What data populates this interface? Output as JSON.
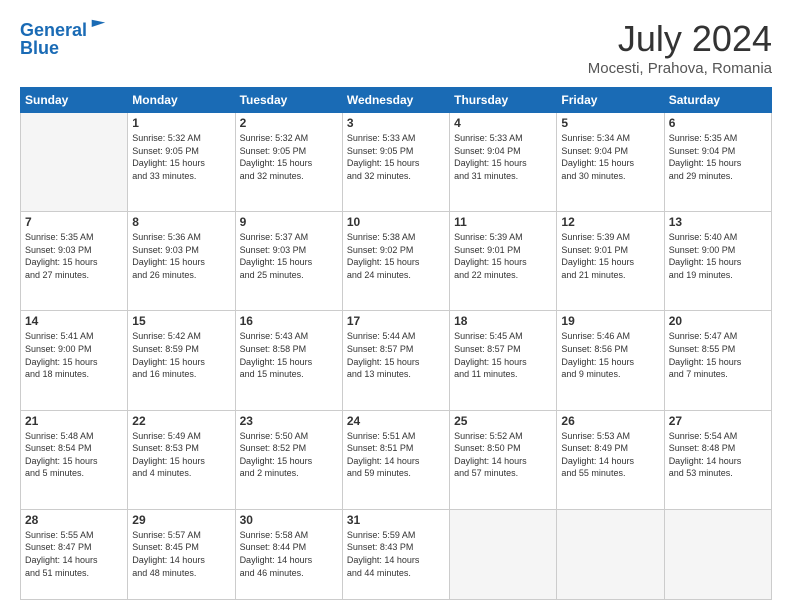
{
  "header": {
    "logo_line1": "General",
    "logo_line2": "Blue",
    "month": "July 2024",
    "location": "Mocesti, Prahova, Romania"
  },
  "weekdays": [
    "Sunday",
    "Monday",
    "Tuesday",
    "Wednesday",
    "Thursday",
    "Friday",
    "Saturday"
  ],
  "weeks": [
    [
      {
        "day": "",
        "info": ""
      },
      {
        "day": "1",
        "info": "Sunrise: 5:32 AM\nSunset: 9:05 PM\nDaylight: 15 hours\nand 33 minutes."
      },
      {
        "day": "2",
        "info": "Sunrise: 5:32 AM\nSunset: 9:05 PM\nDaylight: 15 hours\nand 32 minutes."
      },
      {
        "day": "3",
        "info": "Sunrise: 5:33 AM\nSunset: 9:05 PM\nDaylight: 15 hours\nand 32 minutes."
      },
      {
        "day": "4",
        "info": "Sunrise: 5:33 AM\nSunset: 9:04 PM\nDaylight: 15 hours\nand 31 minutes."
      },
      {
        "day": "5",
        "info": "Sunrise: 5:34 AM\nSunset: 9:04 PM\nDaylight: 15 hours\nand 30 minutes."
      },
      {
        "day": "6",
        "info": "Sunrise: 5:35 AM\nSunset: 9:04 PM\nDaylight: 15 hours\nand 29 minutes."
      }
    ],
    [
      {
        "day": "7",
        "info": "Sunrise: 5:35 AM\nSunset: 9:03 PM\nDaylight: 15 hours\nand 27 minutes."
      },
      {
        "day": "8",
        "info": "Sunrise: 5:36 AM\nSunset: 9:03 PM\nDaylight: 15 hours\nand 26 minutes."
      },
      {
        "day": "9",
        "info": "Sunrise: 5:37 AM\nSunset: 9:03 PM\nDaylight: 15 hours\nand 25 minutes."
      },
      {
        "day": "10",
        "info": "Sunrise: 5:38 AM\nSunset: 9:02 PM\nDaylight: 15 hours\nand 24 minutes."
      },
      {
        "day": "11",
        "info": "Sunrise: 5:39 AM\nSunset: 9:01 PM\nDaylight: 15 hours\nand 22 minutes."
      },
      {
        "day": "12",
        "info": "Sunrise: 5:39 AM\nSunset: 9:01 PM\nDaylight: 15 hours\nand 21 minutes."
      },
      {
        "day": "13",
        "info": "Sunrise: 5:40 AM\nSunset: 9:00 PM\nDaylight: 15 hours\nand 19 minutes."
      }
    ],
    [
      {
        "day": "14",
        "info": "Sunrise: 5:41 AM\nSunset: 9:00 PM\nDaylight: 15 hours\nand 18 minutes."
      },
      {
        "day": "15",
        "info": "Sunrise: 5:42 AM\nSunset: 8:59 PM\nDaylight: 15 hours\nand 16 minutes."
      },
      {
        "day": "16",
        "info": "Sunrise: 5:43 AM\nSunset: 8:58 PM\nDaylight: 15 hours\nand 15 minutes."
      },
      {
        "day": "17",
        "info": "Sunrise: 5:44 AM\nSunset: 8:57 PM\nDaylight: 15 hours\nand 13 minutes."
      },
      {
        "day": "18",
        "info": "Sunrise: 5:45 AM\nSunset: 8:57 PM\nDaylight: 15 hours\nand 11 minutes."
      },
      {
        "day": "19",
        "info": "Sunrise: 5:46 AM\nSunset: 8:56 PM\nDaylight: 15 hours\nand 9 minutes."
      },
      {
        "day": "20",
        "info": "Sunrise: 5:47 AM\nSunset: 8:55 PM\nDaylight: 15 hours\nand 7 minutes."
      }
    ],
    [
      {
        "day": "21",
        "info": "Sunrise: 5:48 AM\nSunset: 8:54 PM\nDaylight: 15 hours\nand 5 minutes."
      },
      {
        "day": "22",
        "info": "Sunrise: 5:49 AM\nSunset: 8:53 PM\nDaylight: 15 hours\nand 4 minutes."
      },
      {
        "day": "23",
        "info": "Sunrise: 5:50 AM\nSunset: 8:52 PM\nDaylight: 15 hours\nand 2 minutes."
      },
      {
        "day": "24",
        "info": "Sunrise: 5:51 AM\nSunset: 8:51 PM\nDaylight: 14 hours\nand 59 minutes."
      },
      {
        "day": "25",
        "info": "Sunrise: 5:52 AM\nSunset: 8:50 PM\nDaylight: 14 hours\nand 57 minutes."
      },
      {
        "day": "26",
        "info": "Sunrise: 5:53 AM\nSunset: 8:49 PM\nDaylight: 14 hours\nand 55 minutes."
      },
      {
        "day": "27",
        "info": "Sunrise: 5:54 AM\nSunset: 8:48 PM\nDaylight: 14 hours\nand 53 minutes."
      }
    ],
    [
      {
        "day": "28",
        "info": "Sunrise: 5:55 AM\nSunset: 8:47 PM\nDaylight: 14 hours\nand 51 minutes."
      },
      {
        "day": "29",
        "info": "Sunrise: 5:57 AM\nSunset: 8:45 PM\nDaylight: 14 hours\nand 48 minutes."
      },
      {
        "day": "30",
        "info": "Sunrise: 5:58 AM\nSunset: 8:44 PM\nDaylight: 14 hours\nand 46 minutes."
      },
      {
        "day": "31",
        "info": "Sunrise: 5:59 AM\nSunset: 8:43 PM\nDaylight: 14 hours\nand 44 minutes."
      },
      {
        "day": "",
        "info": ""
      },
      {
        "day": "",
        "info": ""
      },
      {
        "day": "",
        "info": ""
      }
    ]
  ]
}
